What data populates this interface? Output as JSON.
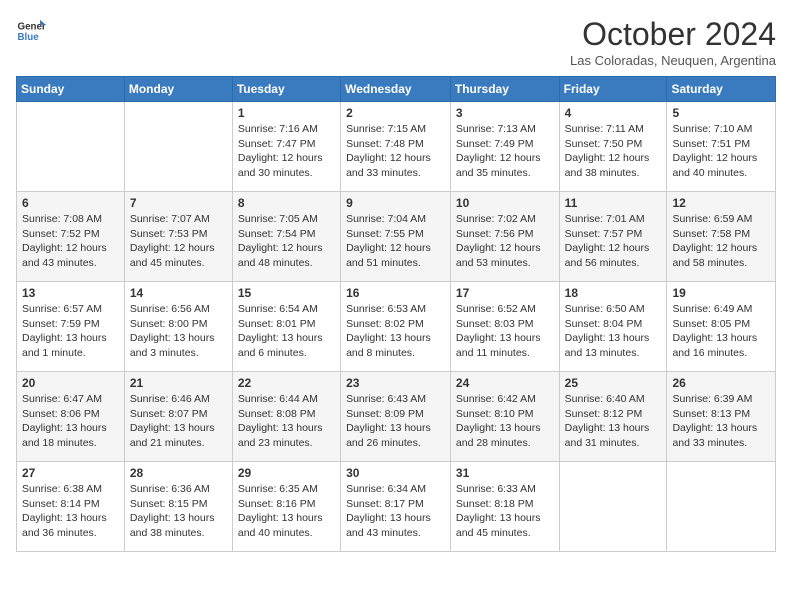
{
  "header": {
    "logo_general": "General",
    "logo_blue": "Blue",
    "month_title": "October 2024",
    "subtitle": "Las Coloradas, Neuquen, Argentina"
  },
  "days_of_week": [
    "Sunday",
    "Monday",
    "Tuesday",
    "Wednesday",
    "Thursday",
    "Friday",
    "Saturday"
  ],
  "weeks": [
    [
      {
        "day": "",
        "info": ""
      },
      {
        "day": "",
        "info": ""
      },
      {
        "day": "1",
        "info": "Sunrise: 7:16 AM\nSunset: 7:47 PM\nDaylight: 12 hours and 30 minutes."
      },
      {
        "day": "2",
        "info": "Sunrise: 7:15 AM\nSunset: 7:48 PM\nDaylight: 12 hours and 33 minutes."
      },
      {
        "day": "3",
        "info": "Sunrise: 7:13 AM\nSunset: 7:49 PM\nDaylight: 12 hours and 35 minutes."
      },
      {
        "day": "4",
        "info": "Sunrise: 7:11 AM\nSunset: 7:50 PM\nDaylight: 12 hours and 38 minutes."
      },
      {
        "day": "5",
        "info": "Sunrise: 7:10 AM\nSunset: 7:51 PM\nDaylight: 12 hours and 40 minutes."
      }
    ],
    [
      {
        "day": "6",
        "info": "Sunrise: 7:08 AM\nSunset: 7:52 PM\nDaylight: 12 hours and 43 minutes."
      },
      {
        "day": "7",
        "info": "Sunrise: 7:07 AM\nSunset: 7:53 PM\nDaylight: 12 hours and 45 minutes."
      },
      {
        "day": "8",
        "info": "Sunrise: 7:05 AM\nSunset: 7:54 PM\nDaylight: 12 hours and 48 minutes."
      },
      {
        "day": "9",
        "info": "Sunrise: 7:04 AM\nSunset: 7:55 PM\nDaylight: 12 hours and 51 minutes."
      },
      {
        "day": "10",
        "info": "Sunrise: 7:02 AM\nSunset: 7:56 PM\nDaylight: 12 hours and 53 minutes."
      },
      {
        "day": "11",
        "info": "Sunrise: 7:01 AM\nSunset: 7:57 PM\nDaylight: 12 hours and 56 minutes."
      },
      {
        "day": "12",
        "info": "Sunrise: 6:59 AM\nSunset: 7:58 PM\nDaylight: 12 hours and 58 minutes."
      }
    ],
    [
      {
        "day": "13",
        "info": "Sunrise: 6:57 AM\nSunset: 7:59 PM\nDaylight: 13 hours and 1 minute."
      },
      {
        "day": "14",
        "info": "Sunrise: 6:56 AM\nSunset: 8:00 PM\nDaylight: 13 hours and 3 minutes."
      },
      {
        "day": "15",
        "info": "Sunrise: 6:54 AM\nSunset: 8:01 PM\nDaylight: 13 hours and 6 minutes."
      },
      {
        "day": "16",
        "info": "Sunrise: 6:53 AM\nSunset: 8:02 PM\nDaylight: 13 hours and 8 minutes."
      },
      {
        "day": "17",
        "info": "Sunrise: 6:52 AM\nSunset: 8:03 PM\nDaylight: 13 hours and 11 minutes."
      },
      {
        "day": "18",
        "info": "Sunrise: 6:50 AM\nSunset: 8:04 PM\nDaylight: 13 hours and 13 minutes."
      },
      {
        "day": "19",
        "info": "Sunrise: 6:49 AM\nSunset: 8:05 PM\nDaylight: 13 hours and 16 minutes."
      }
    ],
    [
      {
        "day": "20",
        "info": "Sunrise: 6:47 AM\nSunset: 8:06 PM\nDaylight: 13 hours and 18 minutes."
      },
      {
        "day": "21",
        "info": "Sunrise: 6:46 AM\nSunset: 8:07 PM\nDaylight: 13 hours and 21 minutes."
      },
      {
        "day": "22",
        "info": "Sunrise: 6:44 AM\nSunset: 8:08 PM\nDaylight: 13 hours and 23 minutes."
      },
      {
        "day": "23",
        "info": "Sunrise: 6:43 AM\nSunset: 8:09 PM\nDaylight: 13 hours and 26 minutes."
      },
      {
        "day": "24",
        "info": "Sunrise: 6:42 AM\nSunset: 8:10 PM\nDaylight: 13 hours and 28 minutes."
      },
      {
        "day": "25",
        "info": "Sunrise: 6:40 AM\nSunset: 8:12 PM\nDaylight: 13 hours and 31 minutes."
      },
      {
        "day": "26",
        "info": "Sunrise: 6:39 AM\nSunset: 8:13 PM\nDaylight: 13 hours and 33 minutes."
      }
    ],
    [
      {
        "day": "27",
        "info": "Sunrise: 6:38 AM\nSunset: 8:14 PM\nDaylight: 13 hours and 36 minutes."
      },
      {
        "day": "28",
        "info": "Sunrise: 6:36 AM\nSunset: 8:15 PM\nDaylight: 13 hours and 38 minutes."
      },
      {
        "day": "29",
        "info": "Sunrise: 6:35 AM\nSunset: 8:16 PM\nDaylight: 13 hours and 40 minutes."
      },
      {
        "day": "30",
        "info": "Sunrise: 6:34 AM\nSunset: 8:17 PM\nDaylight: 13 hours and 43 minutes."
      },
      {
        "day": "31",
        "info": "Sunrise: 6:33 AM\nSunset: 8:18 PM\nDaylight: 13 hours and 45 minutes."
      },
      {
        "day": "",
        "info": ""
      },
      {
        "day": "",
        "info": ""
      }
    ]
  ]
}
